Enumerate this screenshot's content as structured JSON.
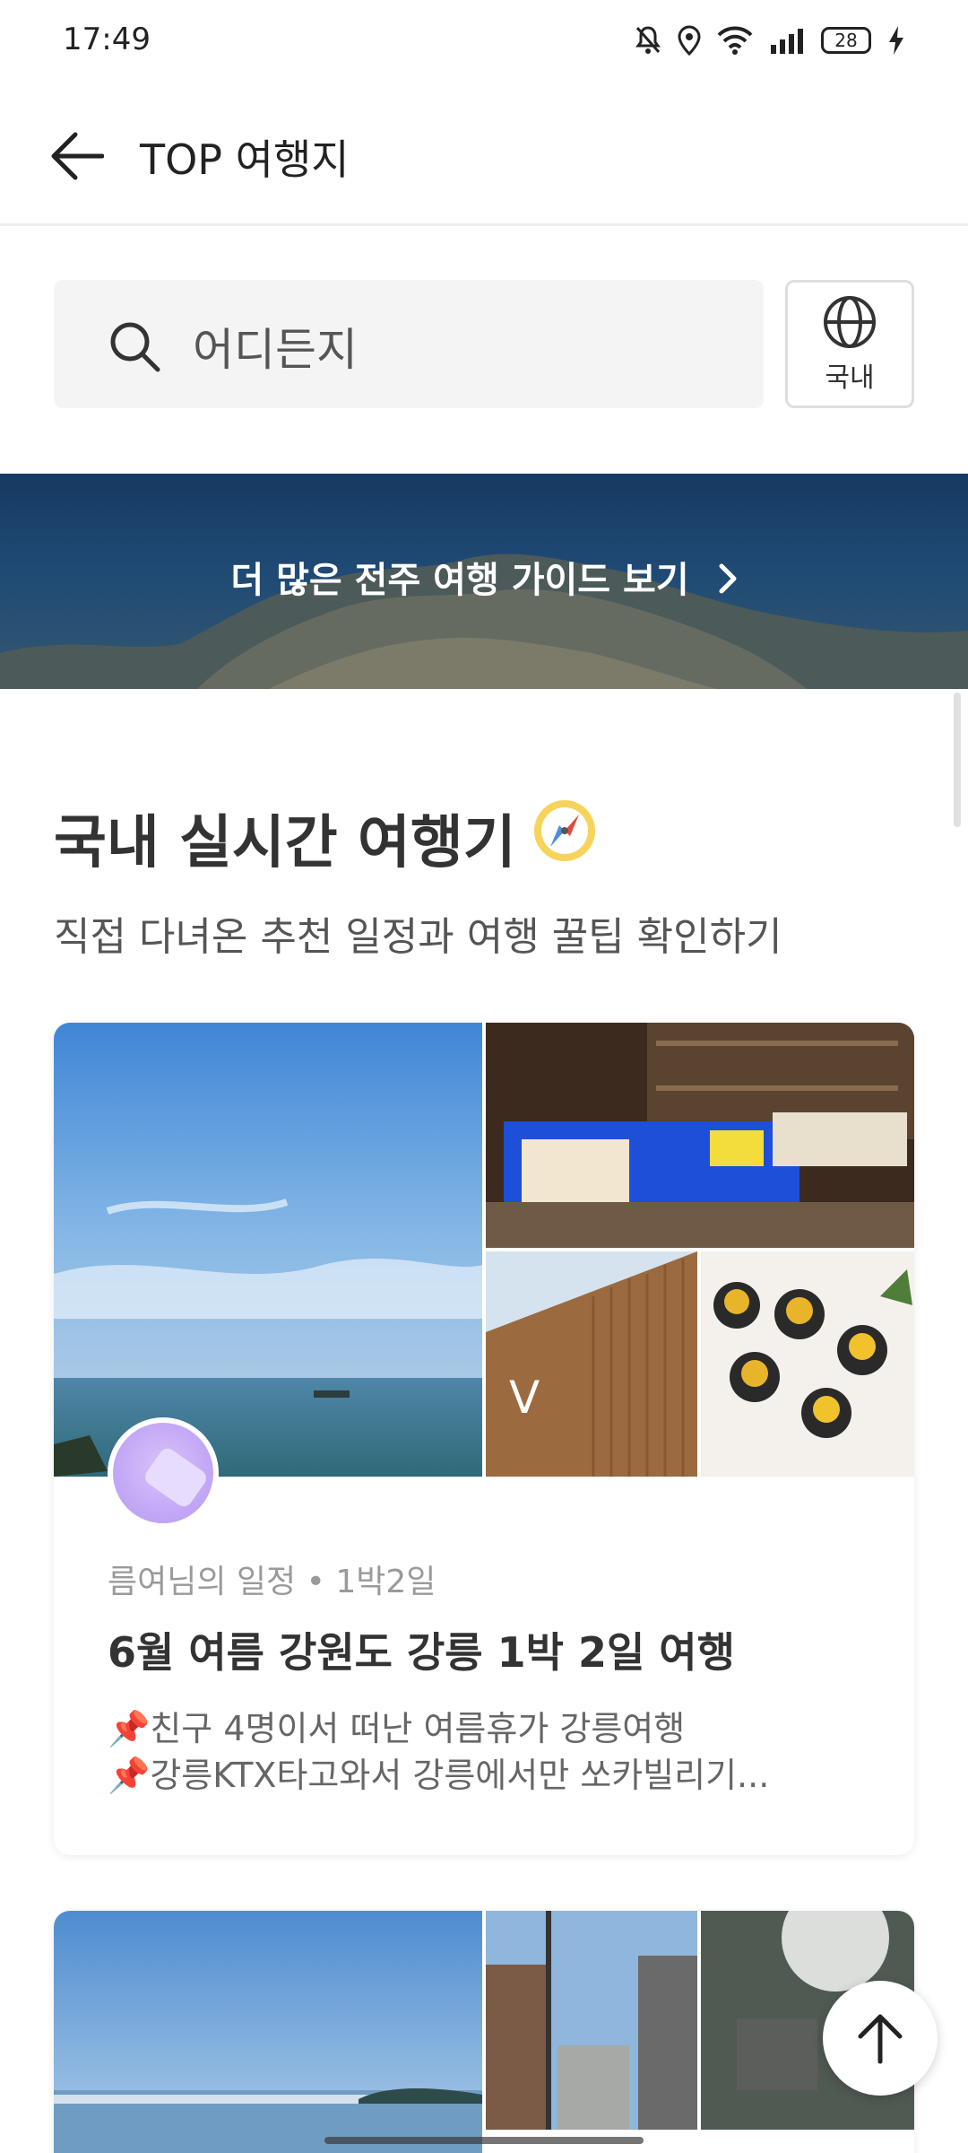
{
  "status_bar": {
    "time": "17:49",
    "battery": "28",
    "icons": [
      "bell-off-icon",
      "location-icon",
      "wifi-icon",
      "signal-icon",
      "battery-icon",
      "charging-icon"
    ]
  },
  "app_bar": {
    "title": "TOP 여행지",
    "back_icon": "arrow-left-icon"
  },
  "search": {
    "value": "어디든지",
    "icon": "search-icon"
  },
  "region_button": {
    "label": "국내",
    "icon": "globe-icon"
  },
  "banner": {
    "text": "더 많은 전주 여행 가이드 보기",
    "icon": "chevron-right-icon"
  },
  "section": {
    "title": "국내 실시간 여행기",
    "emoji": "🧭",
    "subtitle": "직접 다녀온 추천 일정과 여행 꿀팁 확인하기"
  },
  "cards": [
    {
      "meta_user": "름여님의 일정",
      "meta_sep": "•",
      "meta_duration": "1박2일",
      "title": "6월 여름 강원도 강릉 1박 2일 여행",
      "desc_line1": "📌친구 4명이서 떠난 여름휴가 강릉여행",
      "desc_line2": "📌강릉KTX타고와서 강릉에서만 쏘카빌리기..."
    }
  ],
  "fab": {
    "icon": "arrow-up-icon"
  },
  "colors": {
    "banner_bg": "#1f4a74",
    "avatar": "#c3a8f6",
    "search_bg": "#f4f4f4"
  }
}
